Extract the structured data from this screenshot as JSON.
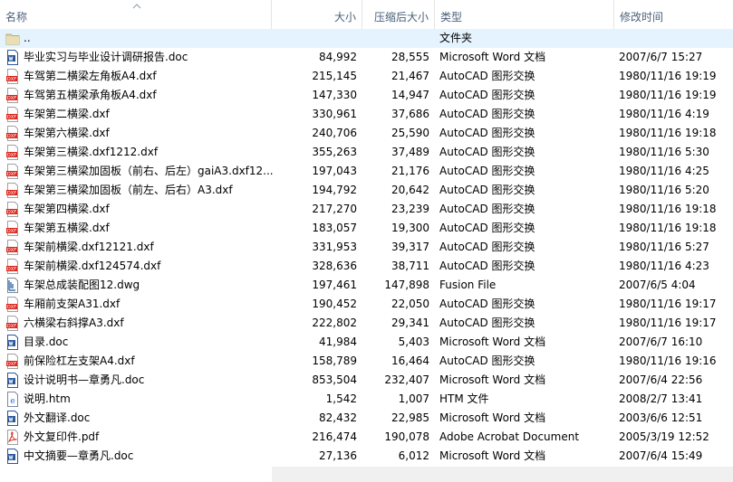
{
  "columns": {
    "name": "名称",
    "size": "大小",
    "compressed": "压缩后大小",
    "type": "类型",
    "modified": "修改时间"
  },
  "rows": [
    {
      "icon": "folder-up-icon",
      "name": "..",
      "size": "",
      "compressed": "",
      "type": "文件夹",
      "modified": ""
    },
    {
      "icon": "word-doc-icon",
      "name": "毕业实习与毕业设计调研报告.doc",
      "size": "84,992",
      "compressed": "28,555",
      "type": "Microsoft Word 文档",
      "modified": "2007/6/7 15:27"
    },
    {
      "icon": "dxf-file-icon",
      "name": "车驾第二横梁左角板A4.dxf",
      "size": "215,145",
      "compressed": "21,467",
      "type": "AutoCAD 图形交换",
      "modified": "1980/11/16 19:19"
    },
    {
      "icon": "dxf-file-icon",
      "name": "车驾第五横梁承角板A4.dxf",
      "size": "147,330",
      "compressed": "14,947",
      "type": "AutoCAD 图形交换",
      "modified": "1980/11/16 19:19"
    },
    {
      "icon": "dxf-file-icon",
      "name": "车架第二横梁.dxf",
      "size": "330,961",
      "compressed": "37,686",
      "type": "AutoCAD 图形交换",
      "modified": "1980/11/16 4:19"
    },
    {
      "icon": "dxf-file-icon",
      "name": "车架第六横梁.dxf",
      "size": "240,706",
      "compressed": "25,590",
      "type": "AutoCAD 图形交换",
      "modified": "1980/11/16 19:18"
    },
    {
      "icon": "dxf-file-icon",
      "name": "车架第三横梁.dxf1212.dxf",
      "size": "355,263",
      "compressed": "37,489",
      "type": "AutoCAD 图形交换",
      "modified": "1980/11/16 5:30"
    },
    {
      "icon": "dxf-file-icon",
      "name": "车架第三横梁加固板（前右、后左）gaiA3.dxf12...",
      "size": "197,043",
      "compressed": "21,176",
      "type": "AutoCAD 图形交换",
      "modified": "1980/11/16 4:25"
    },
    {
      "icon": "dxf-file-icon",
      "name": "车架第三横梁加固板（前左、后右）A3.dxf",
      "size": "194,792",
      "compressed": "20,642",
      "type": "AutoCAD 图形交换",
      "modified": "1980/11/16 5:20"
    },
    {
      "icon": "dxf-file-icon",
      "name": "车架第四横梁.dxf",
      "size": "217,270",
      "compressed": "23,239",
      "type": "AutoCAD 图形交换",
      "modified": "1980/11/16 19:18"
    },
    {
      "icon": "dxf-file-icon",
      "name": "车架第五横梁.dxf",
      "size": "183,057",
      "compressed": "19,300",
      "type": "AutoCAD 图形交换",
      "modified": "1980/11/16 19:18"
    },
    {
      "icon": "dxf-file-icon",
      "name": "车架前横梁.dxf12121.dxf",
      "size": "331,953",
      "compressed": "39,317",
      "type": "AutoCAD 图形交换",
      "modified": "1980/11/16 5:27"
    },
    {
      "icon": "dxf-file-icon",
      "name": "车架前横梁.dxf124574.dxf",
      "size": "328,636",
      "compressed": "38,711",
      "type": "AutoCAD 图形交换",
      "modified": "1980/11/16 4:23"
    },
    {
      "icon": "dwg-file-icon",
      "name": "车架总成装配图12.dwg",
      "size": "197,461",
      "compressed": "147,898",
      "type": "Fusion File",
      "modified": "2007/6/5 4:04"
    },
    {
      "icon": "dxf-file-icon",
      "name": "车厢前支架A31.dxf",
      "size": "190,452",
      "compressed": "22,050",
      "type": "AutoCAD 图形交换",
      "modified": "1980/11/16 19:17"
    },
    {
      "icon": "dxf-file-icon",
      "name": "六横梁右斜撑A3.dxf",
      "size": "222,802",
      "compressed": "29,341",
      "type": "AutoCAD 图形交换",
      "modified": "1980/11/16 19:17"
    },
    {
      "icon": "word-doc-icon",
      "name": "目录.doc",
      "size": "41,984",
      "compressed": "5,403",
      "type": "Microsoft Word 文档",
      "modified": "2007/6/7 16:10"
    },
    {
      "icon": "dxf-file-icon",
      "name": "前保险杠左支架A4.dxf",
      "size": "158,789",
      "compressed": "16,464",
      "type": "AutoCAD 图形交换",
      "modified": "1980/11/16 19:16"
    },
    {
      "icon": "word-doc-icon",
      "name": "设计说明书—章勇凡.doc",
      "size": "853,504",
      "compressed": "232,407",
      "type": "Microsoft Word 文档",
      "modified": "2007/6/4 22:56"
    },
    {
      "icon": "htm-file-icon",
      "name": "说明.htm",
      "size": "1,542",
      "compressed": "1,007",
      "type": "HTM 文件",
      "modified": "2008/2/7 13:41"
    },
    {
      "icon": "word-doc-icon",
      "name": "外文翻译.doc",
      "size": "82,432",
      "compressed": "22,985",
      "type": "Microsoft Word 文档",
      "modified": "2003/6/6 12:51"
    },
    {
      "icon": "pdf-file-icon",
      "name": "外文复印件.pdf",
      "size": "216,474",
      "compressed": "190,078",
      "type": "Adobe Acrobat Document",
      "modified": "2005/3/19 12:52"
    },
    {
      "icon": "word-doc-icon",
      "name": "中文摘要—章勇凡.doc",
      "size": "27,136",
      "compressed": "6,012",
      "type": "Microsoft Word 文档",
      "modified": "2007/6/4 15:49"
    }
  ]
}
